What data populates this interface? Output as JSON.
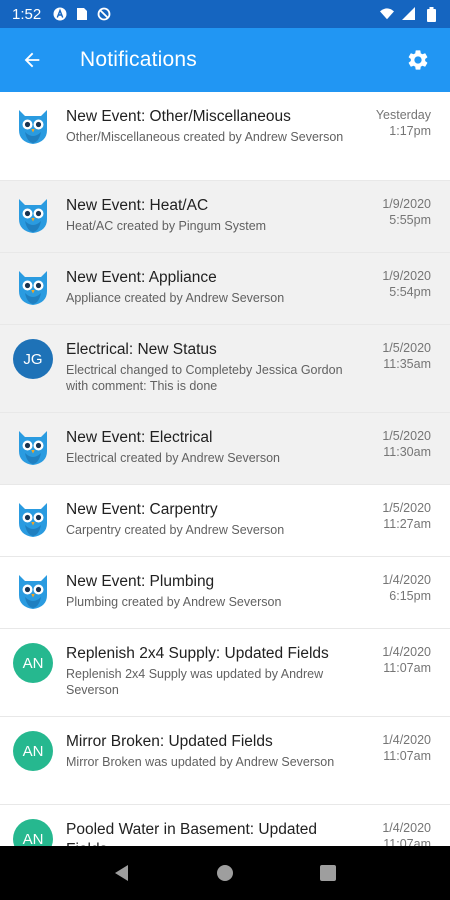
{
  "status_bar": {
    "time": "1:52",
    "icons": [
      "a-icon",
      "sim-card-icon",
      "blocked-icon",
      "wifi-icon",
      "signal-icon",
      "battery-icon"
    ]
  },
  "app_bar": {
    "title": "Notifications",
    "back_icon": "arrow-left-icon",
    "settings_icon": "gear-icon",
    "color": "#2196f3"
  },
  "notifications": [
    {
      "avatar_type": "owl",
      "title": "New Event: Other/Miscellaneous",
      "body": "Other/Miscellaneous created by Andrew Severson",
      "date": "Yesterday",
      "time": "1:17pm",
      "unread": false
    },
    {
      "avatar_type": "owl",
      "title": "New Event: Heat/AC",
      "body": "Heat/AC created by Pingum System",
      "date": "1/9/2020",
      "time": "5:55pm",
      "unread": true
    },
    {
      "avatar_type": "owl",
      "title": "New Event: Appliance",
      "body": "Appliance created by Andrew Severson",
      "date": "1/9/2020",
      "time": "5:54pm",
      "unread": true
    },
    {
      "avatar_type": "initials",
      "initials": "JG",
      "avatar_color": "#1e72b7",
      "title": "Electrical: New Status",
      "body": "Electrical changed to Completeby Jessica Gordon with comment: This is done",
      "date": "1/5/2020",
      "time": "11:35am",
      "unread": true
    },
    {
      "avatar_type": "owl",
      "title": "New Event: Electrical",
      "body": "Electrical created by Andrew Severson",
      "date": "1/5/2020",
      "time": "11:30am",
      "unread": true
    },
    {
      "avatar_type": "owl",
      "title": "New Event: Carpentry",
      "body": "Carpentry created by Andrew Severson",
      "date": "1/5/2020",
      "time": "11:27am",
      "unread": false
    },
    {
      "avatar_type": "owl",
      "title": "New Event: Plumbing",
      "body": "Plumbing created by Andrew Severson",
      "date": "1/4/2020",
      "time": "6:15pm",
      "unread": false
    },
    {
      "avatar_type": "initials",
      "initials": "AN",
      "avatar_color": "#26b88f",
      "title": "Replenish 2x4 Supply: Updated Fields",
      "body": "Replenish 2x4 Supply was updated by Andrew Severson",
      "date": "1/4/2020",
      "time": "11:07am",
      "unread": false
    },
    {
      "avatar_type": "initials",
      "initials": "AN",
      "avatar_color": "#26b88f",
      "title": "Mirror Broken: Updated Fields",
      "body": "Mirror Broken was updated by Andrew Severson",
      "date": "1/4/2020",
      "time": "11:07am",
      "unread": false
    },
    {
      "avatar_type": "initials",
      "initials": "AN",
      "avatar_color": "#26b88f",
      "title": "Pooled Water in Basement: Updated Fields",
      "body": "",
      "date": "1/4/2020",
      "time": "11:07am",
      "unread": false
    }
  ],
  "nav_bar": {
    "icons": [
      "back-triangle-icon",
      "home-circle-icon",
      "recents-square-icon"
    ]
  }
}
